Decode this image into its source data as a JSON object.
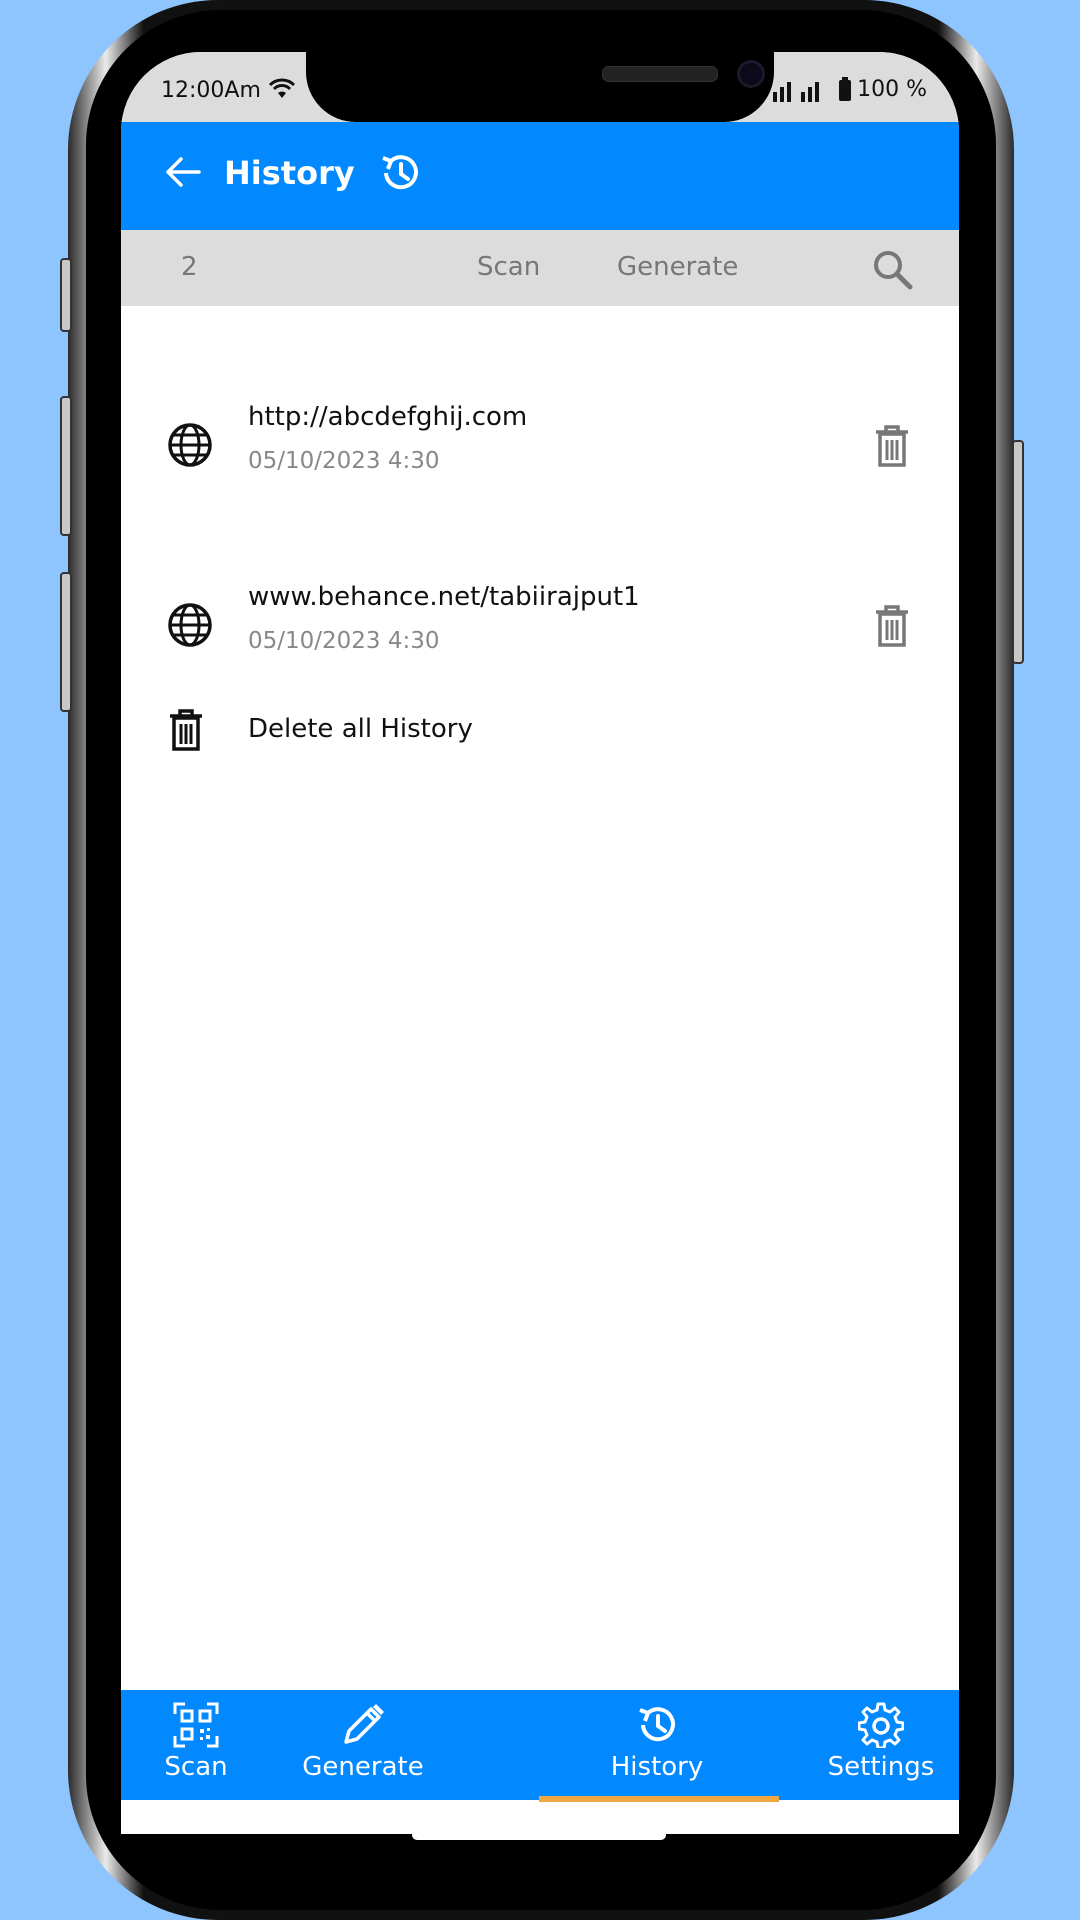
{
  "status": {
    "time": "12:00Am",
    "battery": "100 %"
  },
  "header": {
    "title": "History"
  },
  "subbar": {
    "count": "2",
    "scan": "Scan",
    "generate": "Generate"
  },
  "history": [
    {
      "url": "http://abcdefghij.com",
      "date": "05/10/2023 4:30"
    },
    {
      "url": "www.behance.net/tabiirajput1",
      "date": "05/10/2023 4:30"
    }
  ],
  "delete_all": "Delete all History",
  "nav": {
    "scan": "Scan",
    "generate": "Generate",
    "history": "History",
    "settings": "Settings"
  },
  "colors": {
    "primary": "#0288ff",
    "indicator": "#f0a640",
    "background": "#8fc5ff"
  }
}
